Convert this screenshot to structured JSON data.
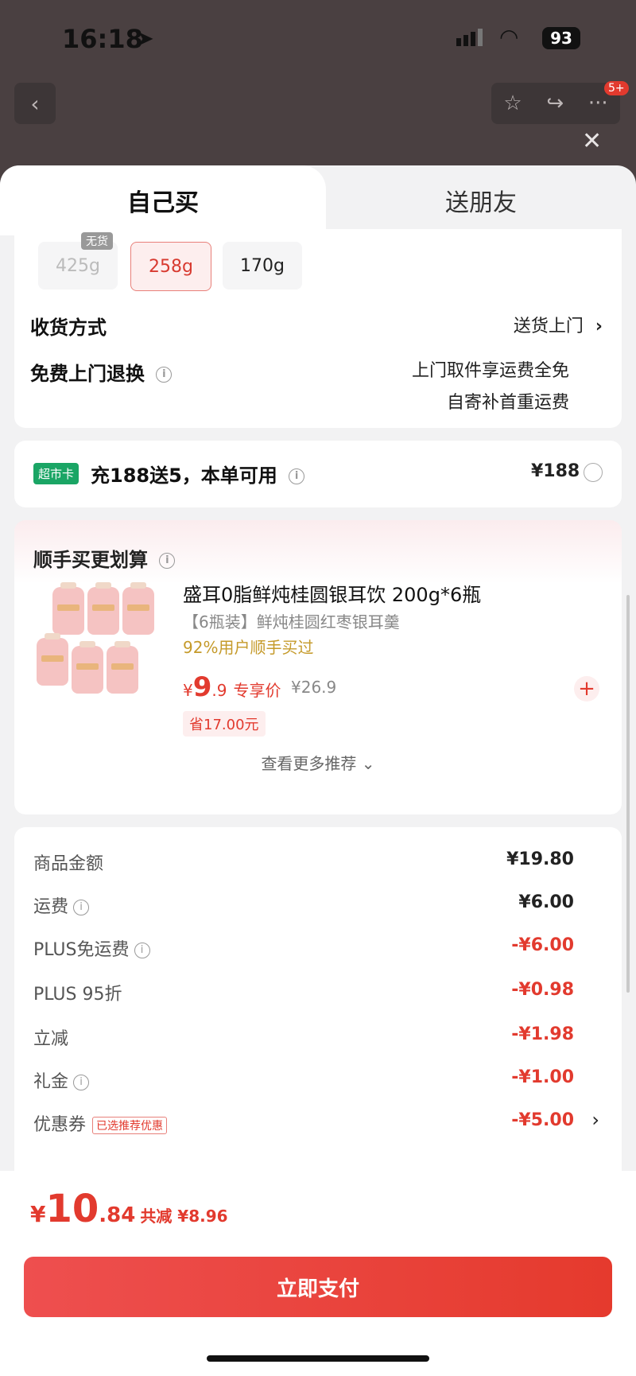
{
  "status_bar": {
    "time": "16:18",
    "battery": "93"
  },
  "nav": {
    "badge": "5+"
  },
  "tabs": {
    "self_buy": "自己买",
    "gift": "送朋友"
  },
  "specs": [
    {
      "label": "425g",
      "tag": "无货",
      "state": "disabled"
    },
    {
      "label": "258g",
      "state": "selected"
    },
    {
      "label": "170g",
      "state": "normal"
    }
  ],
  "delivery": {
    "label": "收货方式",
    "value": "送货上门"
  },
  "returns": {
    "label": "免费上门退换",
    "line1": "上门取件享运费全免",
    "line2": "自寄补首重运费"
  },
  "card_offer": {
    "badge": "超市卡",
    "text": "充188送5，本单可用",
    "price": "¥188"
  },
  "addon": {
    "header": "顺手买更划算",
    "title": "盛耳0脂鲜炖桂圆银耳饮 200g*6瓶",
    "subtitle": "【6瓶装】鲜炖桂圆红枣银耳羹",
    "buy_rate": "92%用户顺手买过",
    "price_yen": "¥",
    "price_int": "9",
    "price_dec": ".9",
    "price_tag": "专享价",
    "original_price": "¥26.9",
    "saving": "省17.00元",
    "more": "查看更多推荐"
  },
  "fees": [
    {
      "label": "商品金额",
      "value": "¥19.80",
      "red": false
    },
    {
      "label": "运费",
      "value": "¥6.00",
      "red": false
    },
    {
      "label": "PLUS免运费",
      "value": "-¥6.00",
      "red": true
    },
    {
      "label": "PLUS 95折",
      "value": "-¥0.98",
      "red": true
    },
    {
      "label": "立减",
      "value": "-¥1.98",
      "red": true
    },
    {
      "label": "礼金",
      "value": "-¥1.00",
      "red": true
    },
    {
      "label": "优惠券",
      "badge": "已选推荐优惠",
      "value": "-¥5.00",
      "red": true
    }
  ],
  "footer": {
    "currency": "¥",
    "total_int": "10",
    "total_dec": ".84",
    "saved": "共减 ¥8.96",
    "pay_button": "立即支付"
  },
  "colors": {
    "accent": "#e23a2e",
    "market_badge": "#1aa565",
    "buy_rate": "#c59a2a"
  }
}
